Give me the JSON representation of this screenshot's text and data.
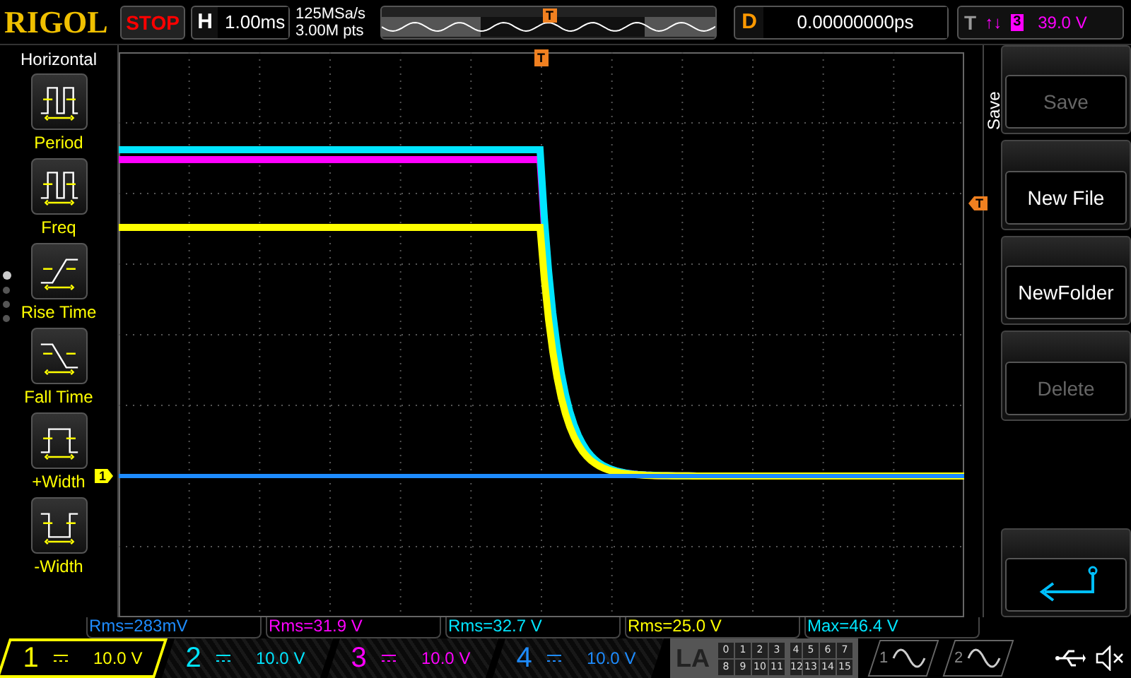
{
  "header": {
    "logo": "RIGOL",
    "run_state": "STOP",
    "horizontal": {
      "label": "H",
      "value": "1.00ms"
    },
    "sample_rate": "125MSa/s",
    "memory_depth": "3.00M pts",
    "memory_trigger": "T",
    "delay": {
      "label": "D",
      "value": "0.00000000ps"
    },
    "trigger": {
      "label": "T",
      "edge": "↑↓",
      "source": "3",
      "level": "39.0 V",
      "color": "#ff00ff"
    }
  },
  "left_menu": {
    "title": "Horizontal",
    "items": [
      {
        "label": "Period"
      },
      {
        "label": "Freq"
      },
      {
        "label": "Rise Time"
      },
      {
        "label": "Fall Time"
      },
      {
        "label": "+Width"
      },
      {
        "label": "-Width"
      }
    ],
    "pages": [
      {
        "selected": true
      },
      {
        "selected": false
      },
      {
        "selected": false
      },
      {
        "selected": false
      }
    ]
  },
  "markers": {
    "trigger_position": "T",
    "trigger_level": "T",
    "channel": "1"
  },
  "measurements": [
    {
      "text": "Rms=283mV",
      "color": "#1e8cff"
    },
    {
      "text": "Rms=31.9 V",
      "color": "#ff00ff"
    },
    {
      "text": "Rms=32.7 V",
      "color": "#00e5ff"
    },
    {
      "text": "Rms=25.0 V",
      "color": "#ffff00"
    },
    {
      "text": "Max=46.4 V",
      "color": "#00e5ff"
    }
  ],
  "channels": [
    {
      "number": "1",
      "scale": "10.0 V",
      "color": "#ffff00",
      "selected": true
    },
    {
      "number": "2",
      "scale": "10.0 V",
      "color": "#00e5ff",
      "selected": false
    },
    {
      "number": "3",
      "scale": "10.0 V",
      "color": "#ff00ff",
      "selected": false
    },
    {
      "number": "4",
      "scale": "10.0 V",
      "color": "#1e8cff",
      "selected": false
    }
  ],
  "logic": {
    "label": "LA",
    "bits": [
      "0",
      "1",
      "2",
      "3",
      "4",
      "5",
      "6",
      "7",
      "8",
      "9",
      "10",
      "11",
      "12",
      "13",
      "14",
      "15"
    ]
  },
  "math": [
    {
      "number": "1"
    },
    {
      "number": "2"
    }
  ],
  "right_menu": {
    "title": "Save",
    "buttons": [
      {
        "label": "Save",
        "disabled": true
      },
      {
        "label": "New File",
        "disabled": false
      },
      {
        "label": "NewFolder",
        "disabled": false
      },
      {
        "label": "Delete",
        "disabled": true
      }
    ]
  }
}
